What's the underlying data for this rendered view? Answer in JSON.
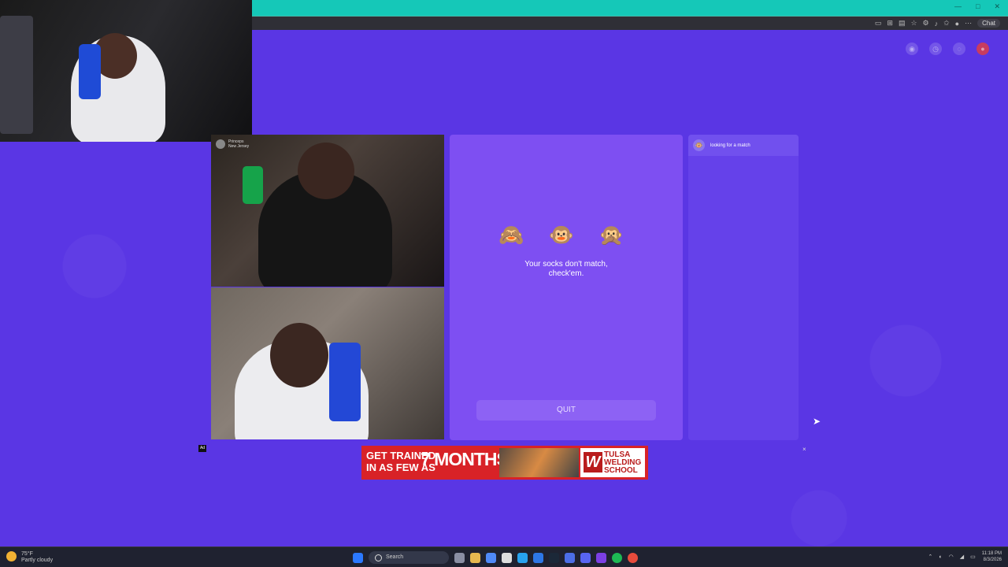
{
  "browser": {
    "chat_label": "Chat",
    "tool_icons": [
      "camera-icon",
      "extension-icon",
      "reader-icon",
      "star-icon",
      "puzzle-icon",
      "music-icon",
      "favorites-icon",
      "profile-icon",
      "more-icon"
    ]
  },
  "video": {
    "partner_name": "Princeps",
    "partner_location": "New Jersey"
  },
  "prompt": {
    "emojis": "🙈 🐵 🙊",
    "text_line1": "Your socks don't match,",
    "text_line2": "check'em.",
    "quit_label": "QUIT"
  },
  "status": {
    "text": "looking for a match"
  },
  "ad": {
    "label": "Ad",
    "close": "×",
    "headline_line1": "GET TRAINED",
    "headline_line2": "IN AS FEW AS",
    "highlight": "7 MONTHS",
    "brand_line1": "TULSA",
    "brand_line2": "WELDING",
    "brand_line3": "SCHOOL"
  },
  "taskbar": {
    "temperature": "75°F",
    "weather": "Partly cloudy",
    "search_placeholder": "Search",
    "time": "11:18 PM",
    "date": "8/3/2026"
  }
}
